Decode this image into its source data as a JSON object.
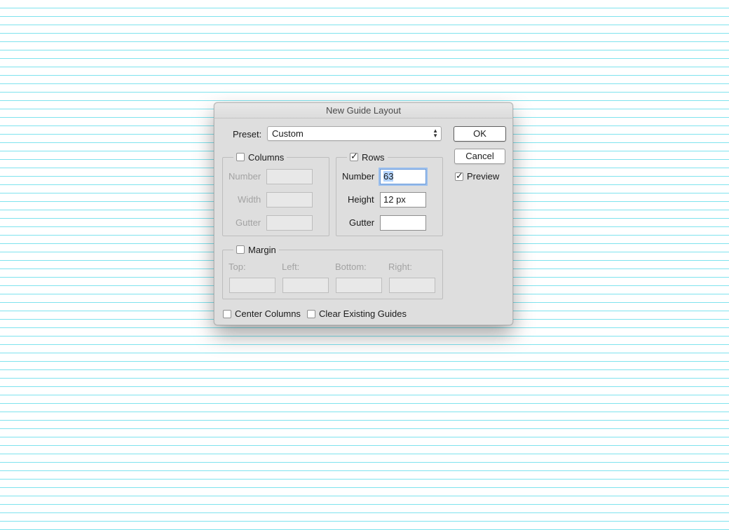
{
  "dialog": {
    "title": "New Guide Layout",
    "preset": {
      "label": "Preset:",
      "value": "Custom"
    },
    "buttons": {
      "ok": "OK",
      "cancel": "Cancel"
    },
    "preview": {
      "label": "Preview",
      "checked": true
    },
    "columns": {
      "label": "Columns",
      "checked": false,
      "number_label": "Number",
      "width_label": "Width",
      "gutter_label": "Gutter",
      "number_value": "",
      "width_value": "",
      "gutter_value": ""
    },
    "rows": {
      "label": "Rows",
      "checked": true,
      "number_label": "Number",
      "height_label": "Height",
      "gutter_label": "Gutter",
      "number_value": "63",
      "height_value": "12 px",
      "gutter_value": ""
    },
    "margin": {
      "label": "Margin",
      "checked": false,
      "top_label": "Top:",
      "left_label": "Left:",
      "bottom_label": "Bottom:",
      "right_label": "Right:"
    },
    "center_columns": {
      "label": "Center Columns",
      "checked": false
    },
    "clear_guides": {
      "label": "Clear Existing Guides",
      "checked": false
    }
  },
  "colors": {
    "guide": "#7fe3ee",
    "dialog_bg": "#dedede",
    "focus": "#9cc0ee"
  }
}
